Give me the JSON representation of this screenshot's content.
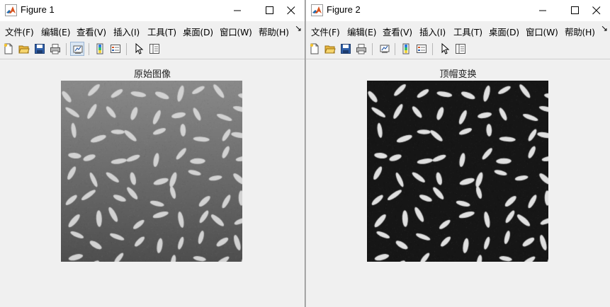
{
  "windows": [
    {
      "title": "Figure 1",
      "axes_title": "原始图像",
      "image": {
        "kind": "rice-grains",
        "variant": "original",
        "background_gradient": [
          "#8a8a8a",
          "#4e4e4e"
        ],
        "grain_color": "#d2d2d2"
      }
    },
    {
      "title": "Figure 2",
      "axes_title": "顶帽变换",
      "image": {
        "kind": "rice-grains",
        "variant": "top-hat",
        "background_gradient": [
          "#161616",
          "#161616"
        ],
        "grain_color": "#e0e0e0"
      }
    }
  ],
  "menu": {
    "items": [
      "文件(F)",
      "编辑(E)",
      "查看(V)",
      "插入(I)",
      "工具(T)",
      "桌面(D)",
      "窗口(W)",
      "帮助(H)"
    ],
    "overflow": "↘"
  },
  "toolbar": {
    "buttons": [
      "new-figure",
      "open-file",
      "save",
      "print",
      "link-plot",
      "insert-colorbar",
      "insert-legend",
      "edit-plot",
      "property-inspector"
    ]
  },
  "window_controls": [
    "minimize",
    "maximize",
    "close"
  ],
  "colors": {
    "matlab_icon": "#d9531e",
    "save_blue": "#2f5fa8",
    "folder": "#e8b640"
  }
}
